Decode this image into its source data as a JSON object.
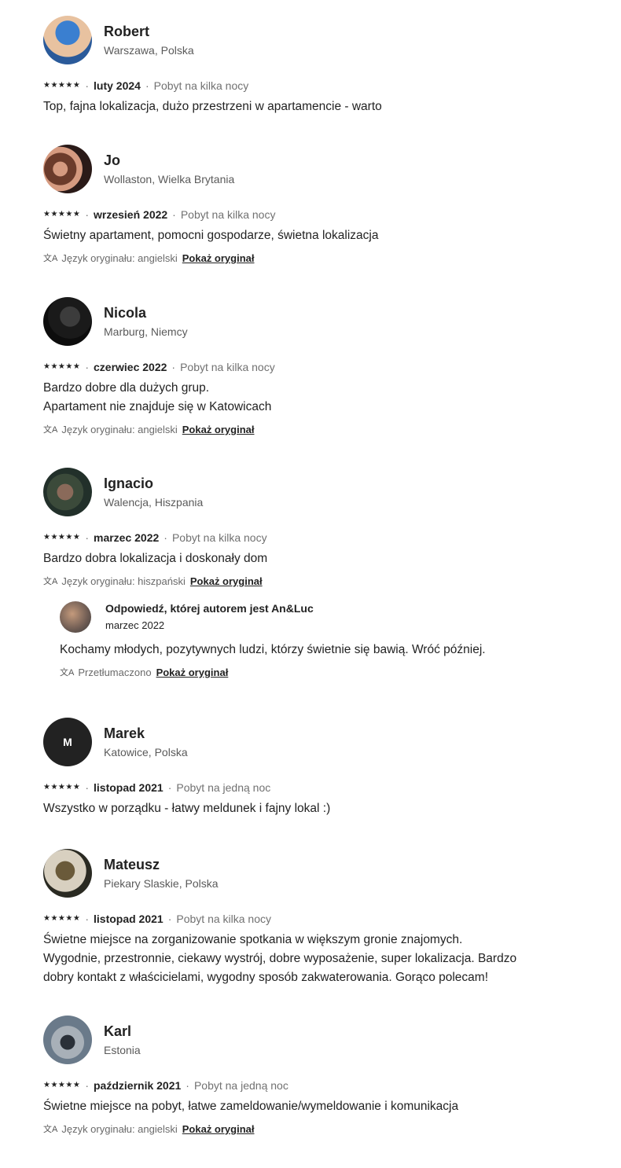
{
  "reviews": [
    {
      "name": "Robert",
      "location": "Warszawa, Polska",
      "avatar": {
        "type": "photo",
        "colors": [
          "#3a7fd0",
          "#e8c2a0",
          "#2a5a9a"
        ]
      },
      "stars": "★★★★★",
      "date": "luty 2024",
      "stay": "Pobyt na kilka nocy",
      "text": "Top, fajna lokalizacja, dużo przestrzeni w apartamencie - warto"
    },
    {
      "name": "Jo",
      "location": "Wollaston, Wielka Brytania",
      "avatar": {
        "type": "photo",
        "colors": [
          "#6b3b2b",
          "#d59a80",
          "#2a1a18"
        ]
      },
      "stars": "★★★★★",
      "date": "wrzesień 2022",
      "stay": "Pobyt na kilka nocy",
      "text": "Świetny apartament, pomocni gospodarze, świetna lokalizacja",
      "translation": {
        "label": "Język oryginału: angielski",
        "link": "Pokaż oryginał"
      }
    },
    {
      "name": "Nicola",
      "location": "Marburg, Niemcy",
      "avatar": {
        "type": "photo",
        "colors": [
          "#0d0d0d",
          "#3c3c3c",
          "#1a1a1a"
        ]
      },
      "stars": "★★★★★",
      "date": "czerwiec 2022",
      "stay": "Pobyt na kilka nocy",
      "text": "Bardzo dobre dla dużych grup.\nApartament nie znajduje się w Katowicach",
      "translation": {
        "label": "Język oryginału: angielski",
        "link": "Pokaż oryginał"
      }
    },
    {
      "name": "Ignacio",
      "location": "Walencja, Hiszpania",
      "avatar": {
        "type": "photo",
        "colors": [
          "#3b4a3a",
          "#8a6a5a",
          "#22302a"
        ]
      },
      "stars": "★★★★★",
      "date": "marzec 2022",
      "stay": "Pobyt na kilka nocy",
      "text": "Bardzo dobra lokalizacja i doskonały dom",
      "translation": {
        "label": "Język oryginału: hiszpański",
        "link": "Pokaż oryginał"
      },
      "response": {
        "title": "Odpowiedź, której autorem jest An&Luc",
        "date": "marzec 2022",
        "text": "Kochamy młodych, pozytywnych ludzi, którzy świetnie się bawią. Wróć później.",
        "translated": "Przetłumaczono",
        "link": "Pokaż oryginał"
      }
    },
    {
      "name": "Marek",
      "location": "Katowice, Polska",
      "avatar": {
        "type": "initial",
        "initial": "M",
        "colors": [
          "#222222"
        ]
      },
      "stars": "★★★★★",
      "date": "listopad 2021",
      "stay": "Pobyt na jedną noc",
      "text": "Wszystko w porządku - łatwy meldunek i fajny lokal :)"
    },
    {
      "name": "Mateusz",
      "location": "Piekary Slaskie, Polska",
      "avatar": {
        "type": "photo",
        "colors": [
          "#d8d0c0",
          "#6a5a3a",
          "#2a2a22"
        ]
      },
      "stars": "★★★★★",
      "date": "listopad 2021",
      "stay": "Pobyt na kilka nocy",
      "text": "Świetne miejsce na zorganizowanie spotkania w większym gronie znajomych.\nWygodnie, przestronnie, ciekawy wystrój, dobre wyposażenie, super lokalizacja. Bardzo\ndobry kontakt z właścicielami, wygodny sposób zakwaterowania. Gorąco polecam!"
    },
    {
      "name": "Karl",
      "location": "Estonia",
      "avatar": {
        "type": "photo",
        "colors": [
          "#6a7a8a",
          "#a8b0b8",
          "#2a3038"
        ]
      },
      "stars": "★★★★★",
      "date": "październik 2021",
      "stay": "Pobyt na jedną noc",
      "text": "Świetne miejsce na pobyt, łatwe zameldowanie/wymeldowanie i komunikacja",
      "translation": {
        "label": "Język oryginału: angielski",
        "link": "Pokaż oryginał"
      }
    }
  ]
}
